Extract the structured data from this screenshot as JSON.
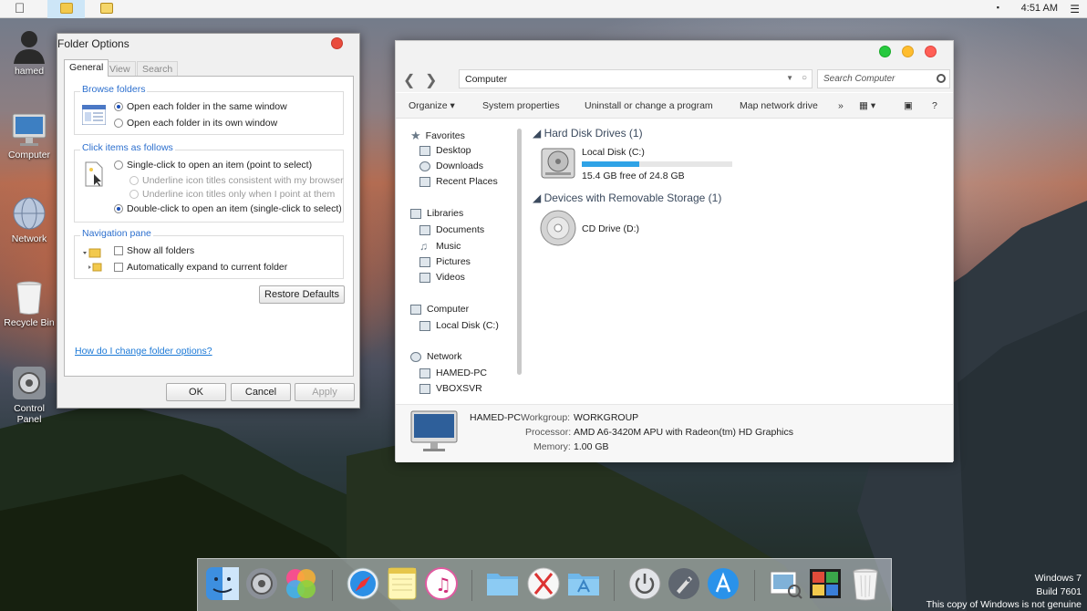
{
  "menubar": {
    "clock": "4:51 AM"
  },
  "desktop_icons": [
    {
      "label": "hamed",
      "icon": "user-icon"
    },
    {
      "label": "Computer",
      "icon": "computer-icon"
    },
    {
      "label": "Network",
      "icon": "network-icon"
    },
    {
      "label": "Recycle Bin",
      "icon": "recycle-bin-icon"
    },
    {
      "label": "Control\nPanel",
      "icon": "control-panel-icon"
    }
  ],
  "folder_options": {
    "title": "Folder Options",
    "tabs": [
      "General",
      "View",
      "Search"
    ],
    "active_tab": "General",
    "browse_folders": {
      "title": "Browse folders",
      "options": [
        "Open each folder in the same window",
        "Open each folder in its own window"
      ],
      "selected": 0
    },
    "click_items": {
      "title": "Click items as follows",
      "single_click": "Single-click to open an item (point to select)",
      "underline_browser": "Underline icon titles consistent with my browser",
      "underline_point": "Underline icon titles only when I point at them",
      "double_click": "Double-click to open an item (single-click to select)",
      "selected": "double"
    },
    "navigation_pane": {
      "title": "Navigation pane",
      "show_all_folders": "Show all folders",
      "auto_expand": "Automatically expand to current folder"
    },
    "restore_defaults": "Restore Defaults",
    "help_link": "How do I change folder options?",
    "buttons": {
      "ok": "OK",
      "cancel": "Cancel",
      "apply": "Apply"
    }
  },
  "explorer": {
    "address": "Computer",
    "search_placeholder": "Search Computer",
    "commands": [
      "Organize",
      "System properties",
      "Uninstall or change a program",
      "Map network drive"
    ],
    "more": "»",
    "help": "?",
    "nav": {
      "favorites": {
        "label": "Favorites",
        "items": [
          "Desktop",
          "Downloads",
          "Recent Places"
        ]
      },
      "libraries": {
        "label": "Libraries",
        "items": [
          "Documents",
          "Music",
          "Pictures",
          "Videos"
        ]
      },
      "computer": {
        "label": "Computer",
        "items": [
          "Local Disk (C:)"
        ]
      },
      "network": {
        "label": "Network",
        "items": [
          "HAMED-PC",
          "VBOXSVR"
        ]
      }
    },
    "hard_disks": {
      "title": "Hard Disk Drives (1)",
      "drive": {
        "name": "Local Disk (C:)",
        "free": "15.4 GB free of 24.8 GB",
        "used_fraction": 0.38
      }
    },
    "removable": {
      "title": "Devices with Removable Storage (1)",
      "drive": {
        "name": "CD Drive (D:)"
      }
    },
    "details": {
      "name": "HAMED-PC",
      "workgroup_label": "Workgroup:",
      "workgroup": "WORKGROUP",
      "processor_label": "Processor:",
      "processor": "AMD A6-3420M APU with Radeon(tm) HD Graphics",
      "memory_label": "Memory:",
      "memory": "1.00 GB"
    }
  },
  "dock_icons": [
    "finder-icon",
    "system-preferences-icon",
    "game-center-icon",
    "safari-icon",
    "notes-icon",
    "itunes-icon",
    "folder-icon",
    "x-icon",
    "applications-folder-icon",
    "power-icon",
    "launchpad-icon",
    "app-store-icon",
    "preview-icon",
    "photo-booth-icon",
    "trash-icon"
  ],
  "watermark": {
    "line1": "Windows 7",
    "line2": "Build 7601",
    "line3": "This copy of Windows is not genuine"
  }
}
